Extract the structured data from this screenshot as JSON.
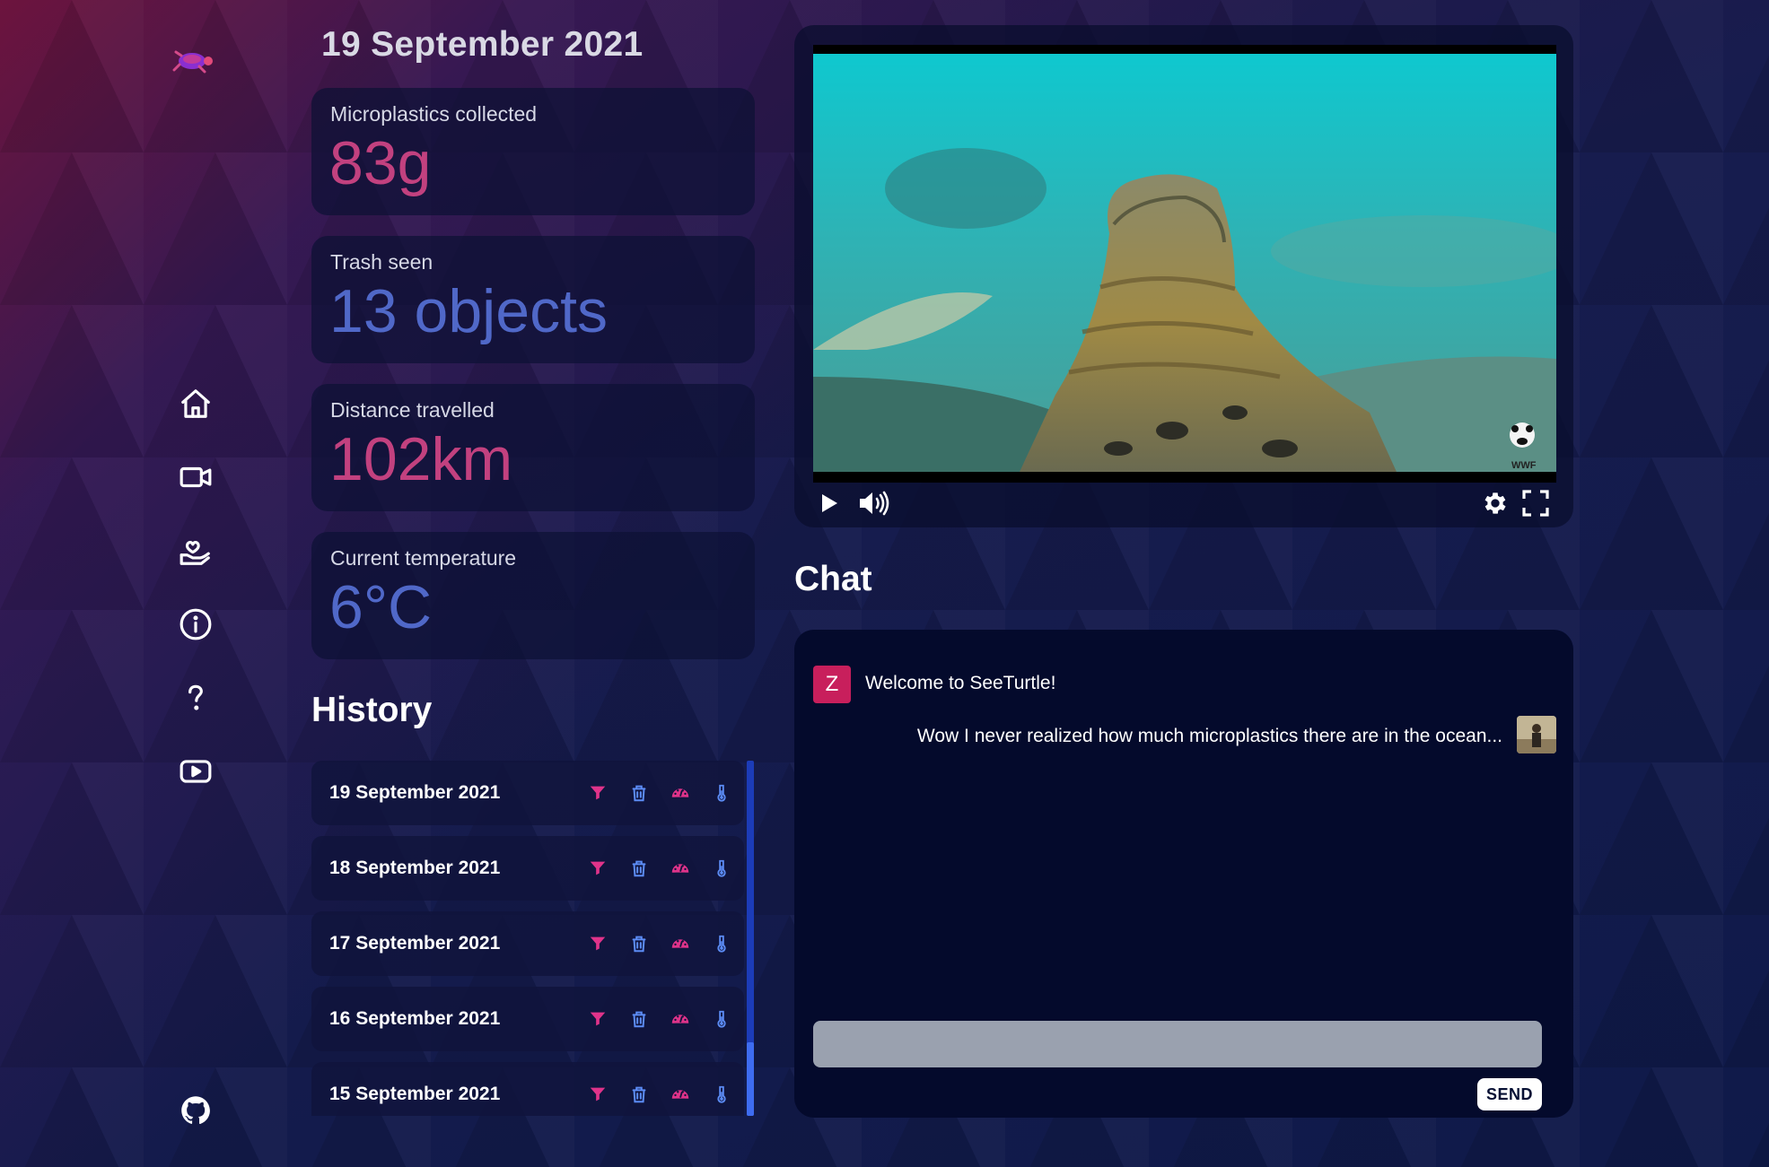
{
  "current_date": "19 September 2021",
  "stats": [
    {
      "label": "Microplastics collected",
      "value": "83g",
      "color": "#c2417f"
    },
    {
      "label": "Trash seen",
      "value": "13 objects",
      "color": "#5068c8"
    },
    {
      "label": "Distance travelled",
      "value": "102km",
      "color": "#c2417f"
    },
    {
      "label": "Current temperature",
      "value": "6°C",
      "color": "#5068c8"
    }
  ],
  "sidebar": {
    "logo_icon": "turtle-logo-icon",
    "items": [
      {
        "icon": "home-icon"
      },
      {
        "icon": "video-camera-icon"
      },
      {
        "icon": "hand-heart-icon"
      },
      {
        "icon": "info-icon"
      },
      {
        "icon": "question-icon"
      },
      {
        "icon": "youtube-icon"
      }
    ],
    "footer_icon": "github-icon"
  },
  "history": {
    "title": "History",
    "rows": [
      {
        "date": "19 September 2021"
      },
      {
        "date": "18 September 2021"
      },
      {
        "date": "17 September 2021"
      },
      {
        "date": "16 September 2021"
      },
      {
        "date": "15 September 2021"
      }
    ],
    "row_icons": [
      "filter-icon",
      "trash-icon",
      "speedometer-icon",
      "thermometer-icon"
    ]
  },
  "video": {
    "watermark": "WWF",
    "controls": [
      "play-icon",
      "volume-icon",
      "settings-icon",
      "fullscreen-icon"
    ]
  },
  "chat": {
    "title": "Chat",
    "messages": [
      {
        "avatar_letter": "Z",
        "text": "Welcome to SeeTurtle!",
        "side": "left"
      },
      {
        "text": "Wow I never realized how much microplastics there are in the ocean...",
        "side": "right"
      }
    ],
    "input_placeholder": "",
    "send_label": "SEND"
  },
  "colors": {
    "accent_pink": "#e0338a",
    "accent_blue": "#5c8cf5",
    "avatar_z": "#c81f5c"
  }
}
